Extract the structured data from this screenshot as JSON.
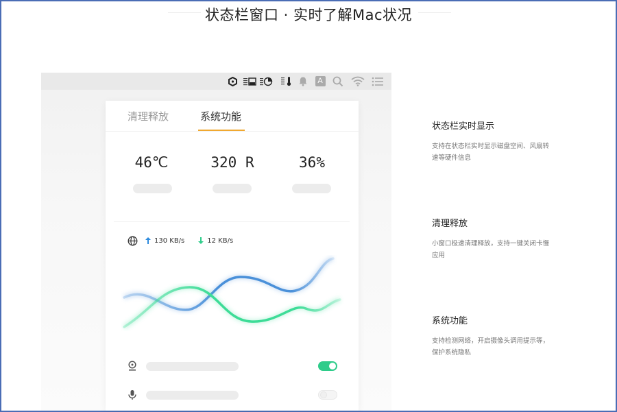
{
  "page": {
    "title": "状态栏窗口 · 实时了解Mac状况"
  },
  "menubar": {
    "icons": [
      "hexagon-icon",
      "cpu-chip-icon",
      "disk-icon",
      "pie-chart-icon",
      "temperature-icon",
      "bell-icon",
      "input-method-icon",
      "search-icon",
      "wifi-icon",
      "list-icon"
    ],
    "input_letter": "A"
  },
  "tabs": [
    {
      "label": "清理释放",
      "active": false
    },
    {
      "label": "系统功能",
      "active": true
    }
  ],
  "stats": [
    {
      "value": "46℃"
    },
    {
      "value": "320 R"
    },
    {
      "value": "36%"
    }
  ],
  "network": {
    "upload": "130 KB/s",
    "download": "12 KB/s"
  },
  "colors": {
    "accent_tab": "#f0a830",
    "toggle_on": "#2ecc8a",
    "wave_blue": "#4a90d9",
    "wave_green": "#3ddc97",
    "arrow_up": "#2e8bde",
    "arrow_down": "#2ecc8a"
  },
  "controls": [
    {
      "icon": "camera-icon",
      "enabled": true
    },
    {
      "icon": "microphone-icon",
      "enabled": false
    }
  ],
  "features": [
    {
      "title": "状态栏实时显示",
      "desc": "支持在状态栏实时显示磁盘空间、风扇转速等硬件信息"
    },
    {
      "title": "清理释放",
      "desc": "小窗口极速清理释放，支持一键关闭卡慢应用"
    },
    {
      "title": "系统功能",
      "desc": "支持检测网络，开启摄像头调用提示等，保护系统隐私"
    }
  ]
}
